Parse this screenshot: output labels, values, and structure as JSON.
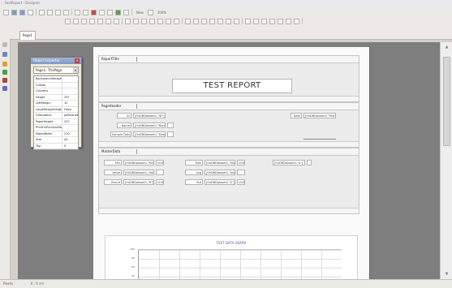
{
  "titlebar": {
    "text": "FastReport - Designer"
  },
  "toolbar": {
    "row1": [
      "new",
      "open",
      "save",
      "print",
      "preview",
      "cut",
      "copy",
      "paste",
      "undo",
      "redo",
      "find",
      "group",
      "align",
      "bring-front",
      "send-back",
      "zoom"
    ],
    "label_new": "New",
    "label_zoom": "100%",
    "row2_count": 28
  },
  "tabs": [
    {
      "label": "Page1"
    }
  ],
  "statusbar": {
    "left": "Ready",
    "pos": "0 ; 0  cm"
  },
  "properties_panel": {
    "title": "Object Inspector",
    "selected_object": "Page1: TfrxPage",
    "rows": [
      {
        "name": "BackgroundImage",
        "value": ""
      },
      {
        "name": "Collate",
        "value": ""
      },
      {
        "name": "Columns",
        "value": ""
      },
      {
        "name": "Height",
        "value": "297"
      },
      {
        "name": "LeftMargin",
        "value": "10"
      },
      {
        "name": "LargeDesignHeight",
        "value": "False"
      },
      {
        "name": "Orientation",
        "value": "poPortrait"
      },
      {
        "name": "PaperHeight",
        "value": "297"
      },
      {
        "name": "PrintOnPreviousPage",
        "value": ""
      },
      {
        "name": "PaperWidth",
        "value": "210"
      },
      {
        "name": "Size",
        "value": "A4"
      },
      {
        "name": "Tag",
        "value": "0"
      }
    ]
  },
  "report": {
    "title_band": {
      "label": "ReportTitle",
      "title": "TEST REPORT"
    },
    "header_band": {
      "label": "PageHeader",
      "fields": [
        {
          "label": "ID",
          "value": "[frxDBDataset1.\"ID\"]"
        },
        {
          "label": "Name",
          "value": "[frxDBDataset1.\"Name\"]"
        },
        {
          "label": "Sample Date",
          "value": "[frxDBDataset1.\"Date\"]"
        },
        {
          "label": "Date",
          "value": "[frxDBDataset1.\"TestDate\"]"
        }
      ]
    },
    "data_band": {
      "label": "MasterData",
      "rows": [
        [
          "Min",
          "[frxDBDataset1.\"Min\"]",
          "Unit",
          "Max",
          "[frxDBDataset1.\"Max\"]",
          "Unit",
          "[frxDBDataset1.\"A\"]"
        ],
        [
          "Value",
          "[frxDBDataset1.\"Value\"]",
          "",
          "Avg",
          "[frxDBDataset1.\"Avg\"]",
          "",
          ""
        ],
        [
          "Result",
          "[frxDBDataset1.\"R\"]",
          "Unit",
          "Std",
          "[frxDBDataset1.\"S\"]",
          "Unit",
          ""
        ]
      ]
    },
    "chart": {
      "title": "TEST DATA GRAPH",
      "y_ticks": [
        "100",
        "80",
        "60",
        "40"
      ]
    }
  }
}
